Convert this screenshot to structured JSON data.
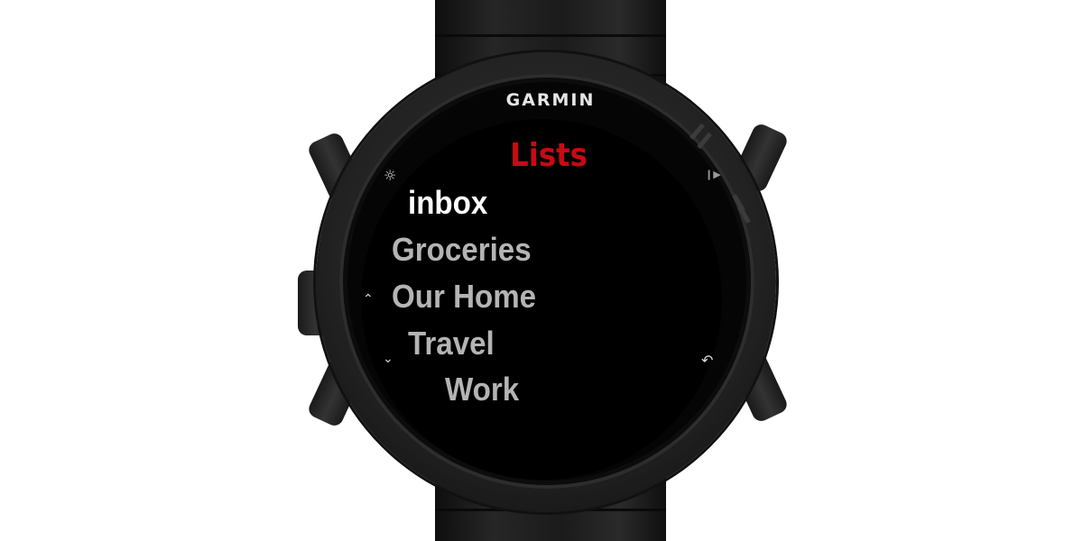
{
  "device": {
    "brand": "GARMIN"
  },
  "screen": {
    "title": "Lists",
    "items": [
      {
        "label": "inbox",
        "selected": true
      },
      {
        "label": "Groceries",
        "selected": false
      },
      {
        "label": "Our Home",
        "selected": false
      },
      {
        "label": "Travel",
        "selected": false
      },
      {
        "label": "Work",
        "selected": false
      }
    ]
  },
  "buttons": {
    "light_icon": "sun-icon",
    "start_icon": "play-icon",
    "up_icon": "chevron-up-icon",
    "down_icon": "chevron-down-icon",
    "back_icon": "back-arrow-icon"
  },
  "colors": {
    "title": "#c80a14",
    "selected_item": "#ffffff",
    "item": "#b4b4b4",
    "screen": "#000000"
  }
}
